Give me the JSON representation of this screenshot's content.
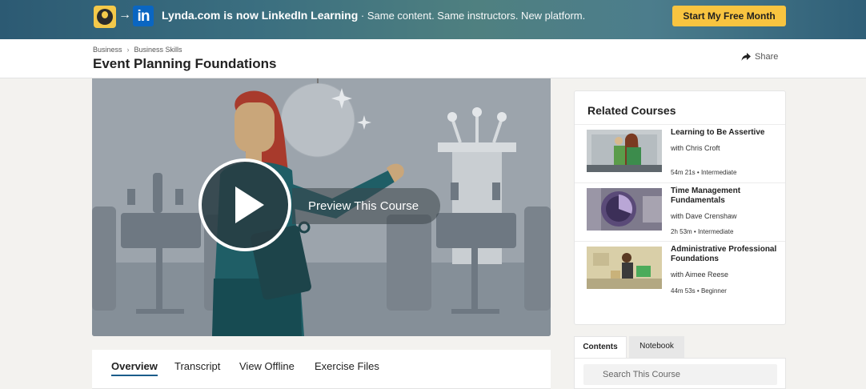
{
  "banner": {
    "brand_text": "Lynda.com is now LinkedIn Learning",
    "separator": " · ",
    "sub_text": "Same content. Same instructors. New platform.",
    "arrow": "→",
    "linkedin_mark": "in",
    "cta_label": "Start My Free Month"
  },
  "header": {
    "breadcrumb": [
      "Business",
      "Business Skills"
    ],
    "breadcrumb_sep": "›",
    "title": "Event Planning Foundations",
    "share_label": "Share"
  },
  "video": {
    "preview_label": "Preview This Course"
  },
  "tabs": [
    "Overview",
    "Transcript",
    "View Offline",
    "Exercise Files"
  ],
  "related": {
    "heading": "Related Courses",
    "courses": [
      {
        "title": "Learning to Be Assertive",
        "author": "with Chris Croft",
        "duration": "54m 21s",
        "level": "Intermediate"
      },
      {
        "title": "Time Management Fundamentals",
        "author": "with Dave Crenshaw",
        "duration": "2h 53m",
        "level": "Intermediate"
      },
      {
        "title": "Administrative Professional Foundations",
        "author": "with Aimee Reese",
        "duration": "44m 53s",
        "level": "Beginner"
      }
    ],
    "meta_sep": " • "
  },
  "panel": {
    "tab_contents": "Contents",
    "tab_notebook": "Notebook",
    "search_placeholder": "Search This Course"
  },
  "colors": {
    "cta": "#f8c440",
    "linkedin": "#0a66c2",
    "active_tab_underline": "#1a5c8a",
    "play_bg": "#2f4b52"
  }
}
